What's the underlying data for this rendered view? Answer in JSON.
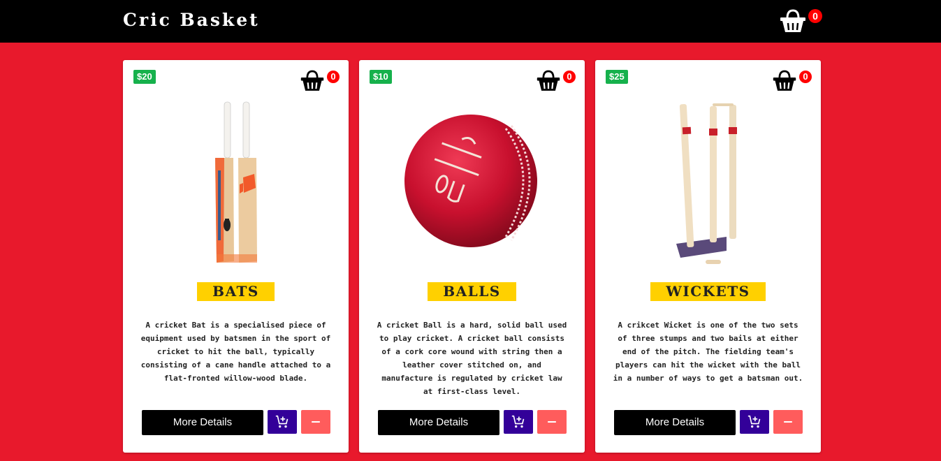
{
  "app": {
    "brand": "Cric Basket",
    "cart_count": "0"
  },
  "products": [
    {
      "price": "$20",
      "cart_count": "0",
      "title": "BATS",
      "description": "A cricket Bat is a specialised piece of equipment used by batsmen in the sport of cricket to hit the ball, typically consisting of a cane handle attached to a flat-fronted willow-wood blade.",
      "details_label": "More Details",
      "image": "cricket-bats"
    },
    {
      "price": "$10",
      "cart_count": "0",
      "title": "BALLS",
      "description": "A cricket Ball is a hard, solid ball used to play cricket. A cricket ball consists of a cork core wound with string then a leather cover stitched on, and manufacture is regulated by cricket law at first-class level.",
      "details_label": "More Details",
      "image": "cricket-ball"
    },
    {
      "price": "$25",
      "cart_count": "0",
      "title": "WICKETS",
      "description": "A crikcet Wicket is one of the two sets of three stumps and two bails at either end of the pitch. The fielding team's players can hit the wicket with the ball in a number of ways to get a batsman out.",
      "details_label": "More Details",
      "image": "cricket-wicket"
    }
  ],
  "colors": {
    "background": "#e8192c",
    "navbar": "#000000",
    "price_badge": "#16b14c",
    "title_bg": "#ffd000",
    "add_button": "#330099",
    "remove_button": "#ff5c5c",
    "count_badge": "#ff0000"
  },
  "icons": {
    "cart": "basket-icon",
    "add": "add-cart-icon",
    "remove": "minus-icon"
  }
}
